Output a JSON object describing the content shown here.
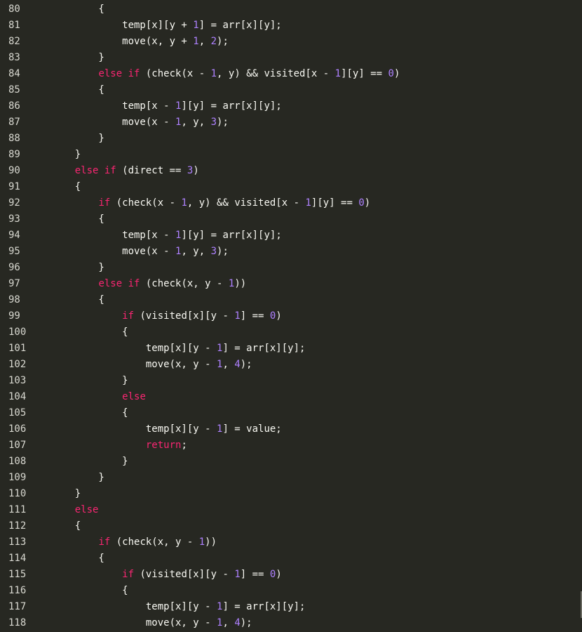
{
  "colors": {
    "background": "#272822",
    "text": "#f8f8f2",
    "keyword": "#f92672",
    "number": "#ae81ff",
    "line_number": "#d8d8d0"
  },
  "lines": [
    {
      "n": "80",
      "tokens": [
        {
          "t": "        {",
          "c": "tx"
        }
      ]
    },
    {
      "n": "81",
      "tokens": [
        {
          "t": "            temp[x][y + ",
          "c": "tx"
        },
        {
          "t": "1",
          "c": "num"
        },
        {
          "t": "] = arr[x][y];",
          "c": "tx"
        }
      ]
    },
    {
      "n": "82",
      "tokens": [
        {
          "t": "            move(x, y + ",
          "c": "tx"
        },
        {
          "t": "1",
          "c": "num"
        },
        {
          "t": ", ",
          "c": "tx"
        },
        {
          "t": "2",
          "c": "num"
        },
        {
          "t": ");",
          "c": "tx"
        }
      ]
    },
    {
      "n": "83",
      "tokens": [
        {
          "t": "        }",
          "c": "tx"
        }
      ]
    },
    {
      "n": "84",
      "tokens": [
        {
          "t": "        ",
          "c": "tx"
        },
        {
          "t": "else if",
          "c": "kw"
        },
        {
          "t": " (check(x - ",
          "c": "tx"
        },
        {
          "t": "1",
          "c": "num"
        },
        {
          "t": ", y) && visited[x - ",
          "c": "tx"
        },
        {
          "t": "1",
          "c": "num"
        },
        {
          "t": "][y] == ",
          "c": "tx"
        },
        {
          "t": "0",
          "c": "num"
        },
        {
          "t": ")",
          "c": "tx"
        }
      ]
    },
    {
      "n": "85",
      "tokens": [
        {
          "t": "        {",
          "c": "tx"
        }
      ]
    },
    {
      "n": "86",
      "tokens": [
        {
          "t": "            temp[x - ",
          "c": "tx"
        },
        {
          "t": "1",
          "c": "num"
        },
        {
          "t": "][y] = arr[x][y];",
          "c": "tx"
        }
      ]
    },
    {
      "n": "87",
      "tokens": [
        {
          "t": "            move(x - ",
          "c": "tx"
        },
        {
          "t": "1",
          "c": "num"
        },
        {
          "t": ", y, ",
          "c": "tx"
        },
        {
          "t": "3",
          "c": "num"
        },
        {
          "t": ");",
          "c": "tx"
        }
      ]
    },
    {
      "n": "88",
      "tokens": [
        {
          "t": "        }",
          "c": "tx"
        }
      ]
    },
    {
      "n": "89",
      "tokens": [
        {
          "t": "    }",
          "c": "tx"
        }
      ]
    },
    {
      "n": "90",
      "tokens": [
        {
          "t": "    ",
          "c": "tx"
        },
        {
          "t": "else if",
          "c": "kw"
        },
        {
          "t": " (direct == ",
          "c": "tx"
        },
        {
          "t": "3",
          "c": "num"
        },
        {
          "t": ")",
          "c": "tx"
        }
      ]
    },
    {
      "n": "91",
      "tokens": [
        {
          "t": "    {",
          "c": "tx"
        }
      ]
    },
    {
      "n": "92",
      "tokens": [
        {
          "t": "        ",
          "c": "tx"
        },
        {
          "t": "if",
          "c": "kw"
        },
        {
          "t": " (check(x - ",
          "c": "tx"
        },
        {
          "t": "1",
          "c": "num"
        },
        {
          "t": ", y) && visited[x - ",
          "c": "tx"
        },
        {
          "t": "1",
          "c": "num"
        },
        {
          "t": "][y] == ",
          "c": "tx"
        },
        {
          "t": "0",
          "c": "num"
        },
        {
          "t": ")",
          "c": "tx"
        }
      ]
    },
    {
      "n": "93",
      "tokens": [
        {
          "t": "        {",
          "c": "tx"
        }
      ]
    },
    {
      "n": "94",
      "tokens": [
        {
          "t": "            temp[x - ",
          "c": "tx"
        },
        {
          "t": "1",
          "c": "num"
        },
        {
          "t": "][y] = arr[x][y];",
          "c": "tx"
        }
      ]
    },
    {
      "n": "95",
      "tokens": [
        {
          "t": "            move(x - ",
          "c": "tx"
        },
        {
          "t": "1",
          "c": "num"
        },
        {
          "t": ", y, ",
          "c": "tx"
        },
        {
          "t": "3",
          "c": "num"
        },
        {
          "t": ");",
          "c": "tx"
        }
      ]
    },
    {
      "n": "96",
      "tokens": [
        {
          "t": "        }",
          "c": "tx"
        }
      ]
    },
    {
      "n": "97",
      "tokens": [
        {
          "t": "        ",
          "c": "tx"
        },
        {
          "t": "else if",
          "c": "kw"
        },
        {
          "t": " (check(x, y - ",
          "c": "tx"
        },
        {
          "t": "1",
          "c": "num"
        },
        {
          "t": "))",
          "c": "tx"
        }
      ]
    },
    {
      "n": "98",
      "tokens": [
        {
          "t": "        {",
          "c": "tx"
        }
      ]
    },
    {
      "n": "99",
      "tokens": [
        {
          "t": "            ",
          "c": "tx"
        },
        {
          "t": "if",
          "c": "kw"
        },
        {
          "t": " (visited[x][y - ",
          "c": "tx"
        },
        {
          "t": "1",
          "c": "num"
        },
        {
          "t": "] == ",
          "c": "tx"
        },
        {
          "t": "0",
          "c": "num"
        },
        {
          "t": ")",
          "c": "tx"
        }
      ]
    },
    {
      "n": "100",
      "tokens": [
        {
          "t": "            {",
          "c": "tx"
        }
      ]
    },
    {
      "n": "101",
      "tokens": [
        {
          "t": "                temp[x][y - ",
          "c": "tx"
        },
        {
          "t": "1",
          "c": "num"
        },
        {
          "t": "] = arr[x][y];",
          "c": "tx"
        }
      ]
    },
    {
      "n": "102",
      "tokens": [
        {
          "t": "                move(x, y - ",
          "c": "tx"
        },
        {
          "t": "1",
          "c": "num"
        },
        {
          "t": ", ",
          "c": "tx"
        },
        {
          "t": "4",
          "c": "num"
        },
        {
          "t": ");",
          "c": "tx"
        }
      ]
    },
    {
      "n": "103",
      "tokens": [
        {
          "t": "            }",
          "c": "tx"
        }
      ]
    },
    {
      "n": "104",
      "tokens": [
        {
          "t": "            ",
          "c": "tx"
        },
        {
          "t": "else",
          "c": "kw"
        }
      ]
    },
    {
      "n": "105",
      "tokens": [
        {
          "t": "            {",
          "c": "tx"
        }
      ]
    },
    {
      "n": "106",
      "tokens": [
        {
          "t": "                temp[x][y - ",
          "c": "tx"
        },
        {
          "t": "1",
          "c": "num"
        },
        {
          "t": "] = value;",
          "c": "tx"
        }
      ]
    },
    {
      "n": "107",
      "tokens": [
        {
          "t": "                ",
          "c": "tx"
        },
        {
          "t": "return",
          "c": "kw"
        },
        {
          "t": ";",
          "c": "tx"
        }
      ]
    },
    {
      "n": "108",
      "tokens": [
        {
          "t": "            }",
          "c": "tx"
        }
      ]
    },
    {
      "n": "109",
      "tokens": [
        {
          "t": "        }",
          "c": "tx"
        }
      ]
    },
    {
      "n": "110",
      "tokens": [
        {
          "t": "    }",
          "c": "tx"
        }
      ]
    },
    {
      "n": "111",
      "tokens": [
        {
          "t": "    ",
          "c": "tx"
        },
        {
          "t": "else",
          "c": "kw"
        }
      ]
    },
    {
      "n": "112",
      "tokens": [
        {
          "t": "    {",
          "c": "tx"
        }
      ]
    },
    {
      "n": "113",
      "tokens": [
        {
          "t": "        ",
          "c": "tx"
        },
        {
          "t": "if",
          "c": "kw"
        },
        {
          "t": " (check(x, y - ",
          "c": "tx"
        },
        {
          "t": "1",
          "c": "num"
        },
        {
          "t": "))",
          "c": "tx"
        }
      ]
    },
    {
      "n": "114",
      "tokens": [
        {
          "t": "        {",
          "c": "tx"
        }
      ]
    },
    {
      "n": "115",
      "tokens": [
        {
          "t": "            ",
          "c": "tx"
        },
        {
          "t": "if",
          "c": "kw"
        },
        {
          "t": " (visited[x][y - ",
          "c": "tx"
        },
        {
          "t": "1",
          "c": "num"
        },
        {
          "t": "] == ",
          "c": "tx"
        },
        {
          "t": "0",
          "c": "num"
        },
        {
          "t": ")",
          "c": "tx"
        }
      ]
    },
    {
      "n": "116",
      "tokens": [
        {
          "t": "            {",
          "c": "tx"
        }
      ]
    },
    {
      "n": "117",
      "tokens": [
        {
          "t": "                temp[x][y - ",
          "c": "tx"
        },
        {
          "t": "1",
          "c": "num"
        },
        {
          "t": "] = arr[x][y];",
          "c": "tx"
        }
      ]
    },
    {
      "n": "118",
      "tokens": [
        {
          "t": "                move(x, y - ",
          "c": "tx"
        },
        {
          "t": "1",
          "c": "num"
        },
        {
          "t": ", ",
          "c": "tx"
        },
        {
          "t": "4",
          "c": "num"
        },
        {
          "t": ");",
          "c": "tx"
        }
      ]
    }
  ]
}
